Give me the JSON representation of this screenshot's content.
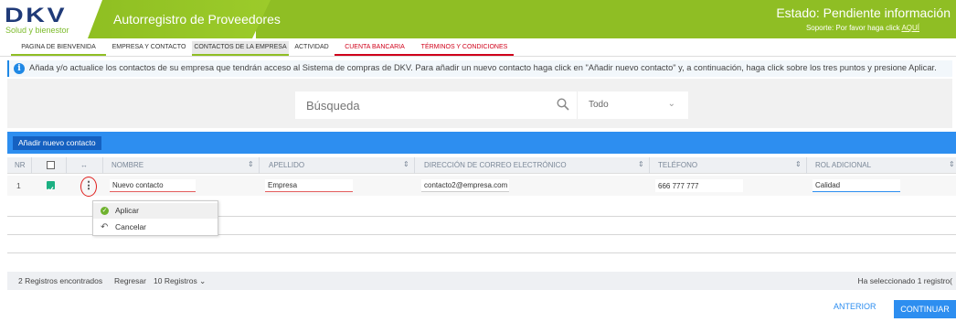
{
  "header": {
    "logo": "DKV",
    "logo_sub": "Solud y bienestor",
    "title": "Autorregistro de Proveedores",
    "status": "Estado: Pendiente información",
    "support_prefix": "Soporte: Por favor haga click",
    "support_link": "AQUÍ"
  },
  "tabs": [
    {
      "label": "PAGINA DE BIENVENIDA"
    },
    {
      "label": "EMPRESA Y CONTACTO"
    },
    {
      "label": "CONTACTOS DE LA EMPRESA"
    },
    {
      "label": "ACTIVIDAD"
    },
    {
      "label": "CUENTA BANCARIA"
    },
    {
      "label": "TÉRMINOS Y CONDICIONES"
    }
  ],
  "info": {
    "text": "Añada y/o actualice los contactos de su empresa que tendrán acceso al Sistema de compras de DKV. Para añadir un nuevo contacto haga click en \"Añadir nuevo contacto\" y, a continuación, haga click sobre los tres puntos y presione Aplicar."
  },
  "search": {
    "placeholder": "Búsqueda",
    "filter_value": "Todo"
  },
  "actions": {
    "add_contact": "Añadir nuevo contacto"
  },
  "table": {
    "columns": {
      "nr": "NR",
      "nombre": "NOMBRE",
      "apellido": "APELLIDO",
      "email": "DIRECCIÓN DE CORREO ELECTRÓNICO",
      "telefono": "TELÉFONO",
      "rol": "ROL ADICIONAL"
    },
    "rows": [
      {
        "nr": "1",
        "nombre": "Nuevo contacto",
        "apellido": "Empresa",
        "email": "contacto2@empresa.com",
        "telefono": "666 777 777",
        "rol": "Calidad"
      }
    ]
  },
  "row_menu": {
    "apply": "Aplicar",
    "cancel": "Cancelar"
  },
  "footer": {
    "count": "2 Registros encontrados",
    "back": "Regresar",
    "page_size": "10 Registros",
    "selected": "Ha seleccionado 1 registro("
  },
  "nav": {
    "prev": "ANTERIOR",
    "next": "CONTINUAR"
  },
  "colors": {
    "brand_green": "#8fbe24",
    "accent_blue": "#2d8ef0",
    "alert_red": "#d0021b"
  }
}
